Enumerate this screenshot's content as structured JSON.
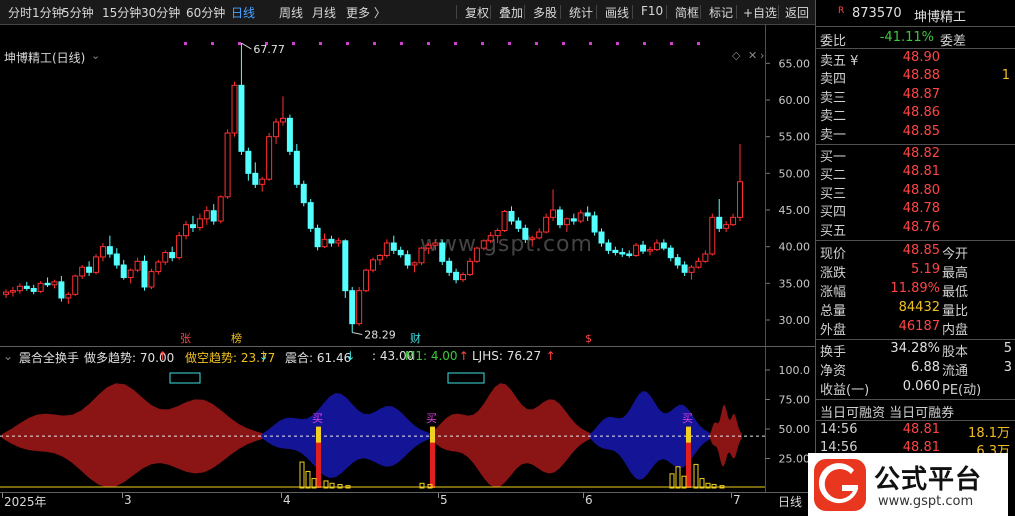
{
  "toolbar": {
    "left_items": [
      "分时",
      "1分钟",
      "5分钟",
      "15分钟",
      "30分钟",
      "60分钟",
      "日线",
      "周线",
      "月线",
      "更多 〉"
    ],
    "active": "日线",
    "right_items": [
      "复权",
      "叠加",
      "多股",
      "统计",
      "画线",
      "F10",
      "简框",
      "标记",
      "+自选",
      "返回"
    ]
  },
  "chart": {
    "title": "坤博精工(日线)",
    "y_ticks": [
      "65.00",
      "60.00",
      "55.00",
      "50.00",
      "45.00",
      "40.00",
      "35.00",
      "30.00"
    ],
    "high_label": "67.77",
    "low_label": "28.29",
    "event_markers": [
      "张",
      "榜",
      "财",
      "$"
    ],
    "watermark": "www.gspt.com"
  },
  "chart_data": {
    "type": "candlestick",
    "ylim": [
      27,
      69
    ],
    "up_color": "#ff3030",
    "down_color": "#54ffff",
    "candles": [
      [
        33.5,
        34.2,
        33.0,
        33.8
      ],
      [
        33.8,
        34.5,
        33.2,
        34.0
      ],
      [
        34.0,
        35.0,
        33.6,
        34.6
      ],
      [
        34.6,
        35.2,
        34.0,
        34.3
      ],
      [
        34.3,
        34.8,
        33.5,
        33.9
      ],
      [
        33.9,
        35.3,
        33.7,
        35.0
      ],
      [
        35.0,
        35.8,
        34.5,
        34.8
      ],
      [
        34.8,
        35.5,
        34.3,
        35.2
      ],
      [
        35.2,
        36.0,
        32.5,
        33.0
      ],
      [
        33.0,
        33.8,
        32.2,
        33.5
      ],
      [
        33.5,
        36.2,
        33.3,
        36.0
      ],
      [
        36.0,
        37.5,
        35.6,
        37.2
      ],
      [
        37.2,
        38.0,
        36.0,
        36.5
      ],
      [
        36.5,
        39.0,
        36.2,
        38.6
      ],
      [
        38.6,
        40.5,
        38.0,
        40.0
      ],
      [
        40.0,
        41.5,
        38.5,
        39.0
      ],
      [
        39.0,
        39.8,
        37.0,
        37.5
      ],
      [
        37.5,
        38.2,
        35.5,
        35.8
      ],
      [
        35.8,
        37.0,
        35.0,
        36.8
      ],
      [
        36.8,
        38.5,
        36.5,
        38.0
      ],
      [
        38.0,
        38.8,
        34.0,
        34.5
      ],
      [
        34.5,
        37.0,
        34.2,
        36.6
      ],
      [
        36.6,
        38.2,
        36.2,
        37.9
      ],
      [
        37.9,
        39.5,
        37.5,
        39.2
      ],
      [
        39.2,
        40.0,
        38.0,
        38.5
      ],
      [
        38.5,
        42.0,
        38.2,
        41.5
      ],
      [
        41.5,
        43.5,
        41.0,
        43.0
      ],
      [
        43.0,
        44.2,
        42.0,
        42.6
      ],
      [
        42.6,
        44.5,
        42.2,
        43.8
      ],
      [
        43.8,
        45.5,
        43.0,
        44.9
      ],
      [
        44.9,
        45.8,
        43.0,
        43.5
      ],
      [
        43.5,
        47.0,
        43.2,
        46.8
      ],
      [
        46.8,
        56.0,
        46.5,
        55.5
      ],
      [
        55.5,
        62.5,
        55.0,
        62.0
      ],
      [
        62.0,
        67.77,
        52.5,
        53.0
      ],
      [
        53.0,
        53.5,
        49.0,
        50.0
      ],
      [
        50.0,
        51.5,
        48.0,
        48.5
      ],
      [
        48.5,
        49.5,
        47.5,
        49.2
      ],
      [
        49.2,
        55.5,
        49.0,
        55.0
      ],
      [
        55.0,
        57.5,
        54.0,
        57.0
      ],
      [
        57.0,
        60.5,
        56.5,
        57.5
      ],
      [
        57.5,
        58.0,
        52.5,
        53.0
      ],
      [
        53.0,
        54.0,
        48.0,
        48.5
      ],
      [
        48.5,
        49.0,
        45.5,
        46.0
      ],
      [
        46.0,
        46.5,
        42.0,
        42.5
      ],
      [
        42.5,
        43.0,
        39.5,
        40.0
      ],
      [
        40.0,
        41.8,
        39.8,
        41.0
      ],
      [
        41.0,
        41.5,
        40.0,
        40.5
      ],
      [
        40.5,
        41.2,
        40.0,
        40.8
      ],
      [
        40.8,
        41.0,
        33.0,
        34.0
      ],
      [
        34.0,
        34.5,
        28.29,
        29.5
      ],
      [
        29.5,
        34.5,
        29.2,
        34.0
      ],
      [
        34.0,
        37.0,
        33.8,
        36.8
      ],
      [
        36.8,
        38.5,
        36.5,
        38.2
      ],
      [
        38.2,
        39.0,
        37.5,
        38.8
      ],
      [
        38.8,
        41.0,
        38.5,
        40.5
      ],
      [
        40.5,
        41.5,
        39.0,
        39.5
      ],
      [
        39.5,
        40.0,
        38.5,
        38.9
      ],
      [
        38.9,
        39.5,
        37.0,
        37.5
      ],
      [
        37.5,
        38.0,
        36.5,
        37.8
      ],
      [
        37.8,
        40.0,
        37.5,
        39.8
      ],
      [
        39.8,
        40.5,
        39.0,
        40.2
      ],
      [
        40.2,
        41.0,
        39.5,
        40.5
      ],
      [
        40.5,
        41.0,
        37.5,
        38.0
      ],
      [
        38.0,
        38.5,
        36.0,
        36.5
      ],
      [
        36.5,
        37.0,
        35.0,
        35.5
      ],
      [
        35.5,
        36.5,
        35.2,
        36.2
      ],
      [
        36.2,
        38.5,
        36.0,
        38.0
      ],
      [
        38.0,
        40.0,
        37.8,
        39.8
      ],
      [
        39.8,
        41.0,
        39.5,
        40.8
      ],
      [
        40.8,
        42.0,
        40.5,
        41.5
      ],
      [
        41.5,
        42.5,
        40.5,
        42.2
      ],
      [
        42.2,
        45.0,
        42.0,
        44.8
      ],
      [
        44.8,
        45.5,
        43.0,
        43.5
      ],
      [
        43.5,
        44.0,
        42.0,
        42.5
      ],
      [
        42.5,
        43.0,
        40.5,
        41.0
      ],
      [
        41.0,
        41.5,
        40.0,
        41.2
      ],
      [
        41.2,
        42.5,
        41.0,
        42.0
      ],
      [
        42.0,
        44.5,
        41.8,
        44.0
      ],
      [
        44.0,
        47.8,
        43.5,
        45.0
      ],
      [
        45.0,
        45.5,
        42.5,
        43.0
      ],
      [
        43.0,
        44.0,
        42.0,
        43.8
      ],
      [
        43.8,
        44.5,
        43.0,
        43.5
      ],
      [
        43.5,
        45.0,
        43.2,
        44.6
      ],
      [
        44.6,
        45.5,
        43.5,
        44.2
      ],
      [
        44.2,
        44.8,
        41.5,
        42.0
      ],
      [
        42.0,
        42.5,
        40.0,
        40.5
      ],
      [
        40.5,
        41.0,
        39.0,
        39.5
      ],
      [
        39.5,
        40.0,
        38.8,
        39.2
      ],
      [
        39.2,
        39.8,
        38.6,
        39.0
      ],
      [
        39.0,
        39.5,
        38.5,
        38.8
      ],
      [
        38.8,
        40.5,
        38.6,
        40.2
      ],
      [
        40.2,
        40.8,
        39.0,
        39.4
      ],
      [
        39.4,
        40.0,
        38.8,
        39.6
      ],
      [
        39.6,
        41.0,
        39.4,
        40.5
      ],
      [
        40.5,
        41.0,
        39.5,
        39.8
      ],
      [
        39.8,
        40.2,
        38.0,
        38.5
      ],
      [
        38.5,
        39.0,
        37.0,
        37.5
      ],
      [
        37.5,
        38.0,
        36.0,
        36.5
      ],
      [
        36.5,
        37.5,
        35.5,
        37.2
      ],
      [
        37.2,
        38.5,
        37.0,
        38.0
      ],
      [
        38.0,
        39.5,
        37.8,
        39.0
      ],
      [
        39.0,
        44.5,
        38.8,
        44.0
      ],
      [
        44.0,
        46.5,
        42.0,
        42.5
      ],
      [
        42.5,
        43.5,
        42.0,
        43.0
      ],
      [
        43.0,
        44.5,
        42.8,
        44.0
      ],
      [
        44.0,
        54.0,
        43.5,
        48.85
      ]
    ]
  },
  "indicator": {
    "name": "震合全换手",
    "items": [
      {
        "label": "做多趋势: 70.00",
        "arrow": "↑",
        "color": "#e0e0e0",
        "arrow_color": "#ff4545"
      },
      {
        "label": "做空趋势: 23.77",
        "arrow": "↓",
        "color": "#f0c020",
        "arrow_color": "#3ee0e0"
      },
      {
        "label": "震合: 61.46",
        "arrow": "↓",
        "color": "#e0e0e0",
        "arrow_color": "#3ee0e0"
      },
      {
        "label": ": 43.00",
        "arrow": "",
        "color": "#e0e0e0",
        "arrow_color": "#e0e0e0"
      },
      {
        "label": "M1: 4.00",
        "arrow": "↑",
        "color": "#3cc83c",
        "arrow_color": "#ff4545"
      },
      {
        "label": "LJHS: 76.27",
        "arrow": "↑",
        "color": "#e0e0e0",
        "arrow_color": "#ff4545"
      }
    ],
    "y_ticks": [
      "100.0",
      "75.00",
      "50.00",
      "25.00"
    ],
    "buy_label": "买"
  },
  "x_axis": {
    "labels": [
      "2025年",
      "3",
      "4",
      "5",
      "6",
      "7"
    ],
    "period": "日线"
  },
  "quote": {
    "badge": "R",
    "code": "873570",
    "name": "坤博精工",
    "weibi_label": "委比",
    "weibi_value": "-41.11%",
    "weicha_label": "委差",
    "asks": [
      {
        "label": "卖五 ¥",
        "price": "48.90"
      },
      {
        "label": "卖四",
        "price": "48.88",
        "vol": "1"
      },
      {
        "label": "卖三",
        "price": "48.87"
      },
      {
        "label": "卖二",
        "price": "48.86"
      },
      {
        "label": "卖一",
        "price": "48.85"
      }
    ],
    "bids": [
      {
        "label": "买一",
        "price": "48.82"
      },
      {
        "label": "买二",
        "price": "48.81"
      },
      {
        "label": "买三",
        "price": "48.80"
      },
      {
        "label": "买四",
        "price": "48.78"
      },
      {
        "label": "买五",
        "price": "48.76"
      }
    ],
    "stats": [
      {
        "label": "现价",
        "value": "48.85",
        "value_color": "#ff4545",
        "label2": "今开"
      },
      {
        "label": "涨跌",
        "value": "5.19",
        "value_color": "#ff4545",
        "label2": "最高"
      },
      {
        "label": "涨幅",
        "value": "11.89%",
        "value_color": "#ff4545",
        "label2": "最低"
      },
      {
        "label": "总量",
        "value": "84432",
        "value_color": "#f0c020",
        "label2": "量比"
      },
      {
        "label": "外盘",
        "value": "46187",
        "value_color": "#ff4545",
        "label2": "内盘"
      }
    ],
    "stats2": [
      {
        "label": "换手",
        "value": "34.28%",
        "label2": "股本",
        "extra": "5"
      },
      {
        "label": "净资",
        "value": "6.88",
        "label2": "流通",
        "extra": "3"
      },
      {
        "label": "收益(一)",
        "value": "0.060",
        "label2": "PE(动)",
        "extra": ""
      }
    ],
    "margin_header": "当日可融资 当日可融券",
    "ticks": [
      {
        "time": "14:56",
        "price": "48.81",
        "vol": "18.1万"
      },
      {
        "time": "14:56",
        "price": "48.81",
        "vol": "6.3万"
      }
    ]
  },
  "logo": {
    "title": "公式平台",
    "url": "www.gspt.com"
  }
}
